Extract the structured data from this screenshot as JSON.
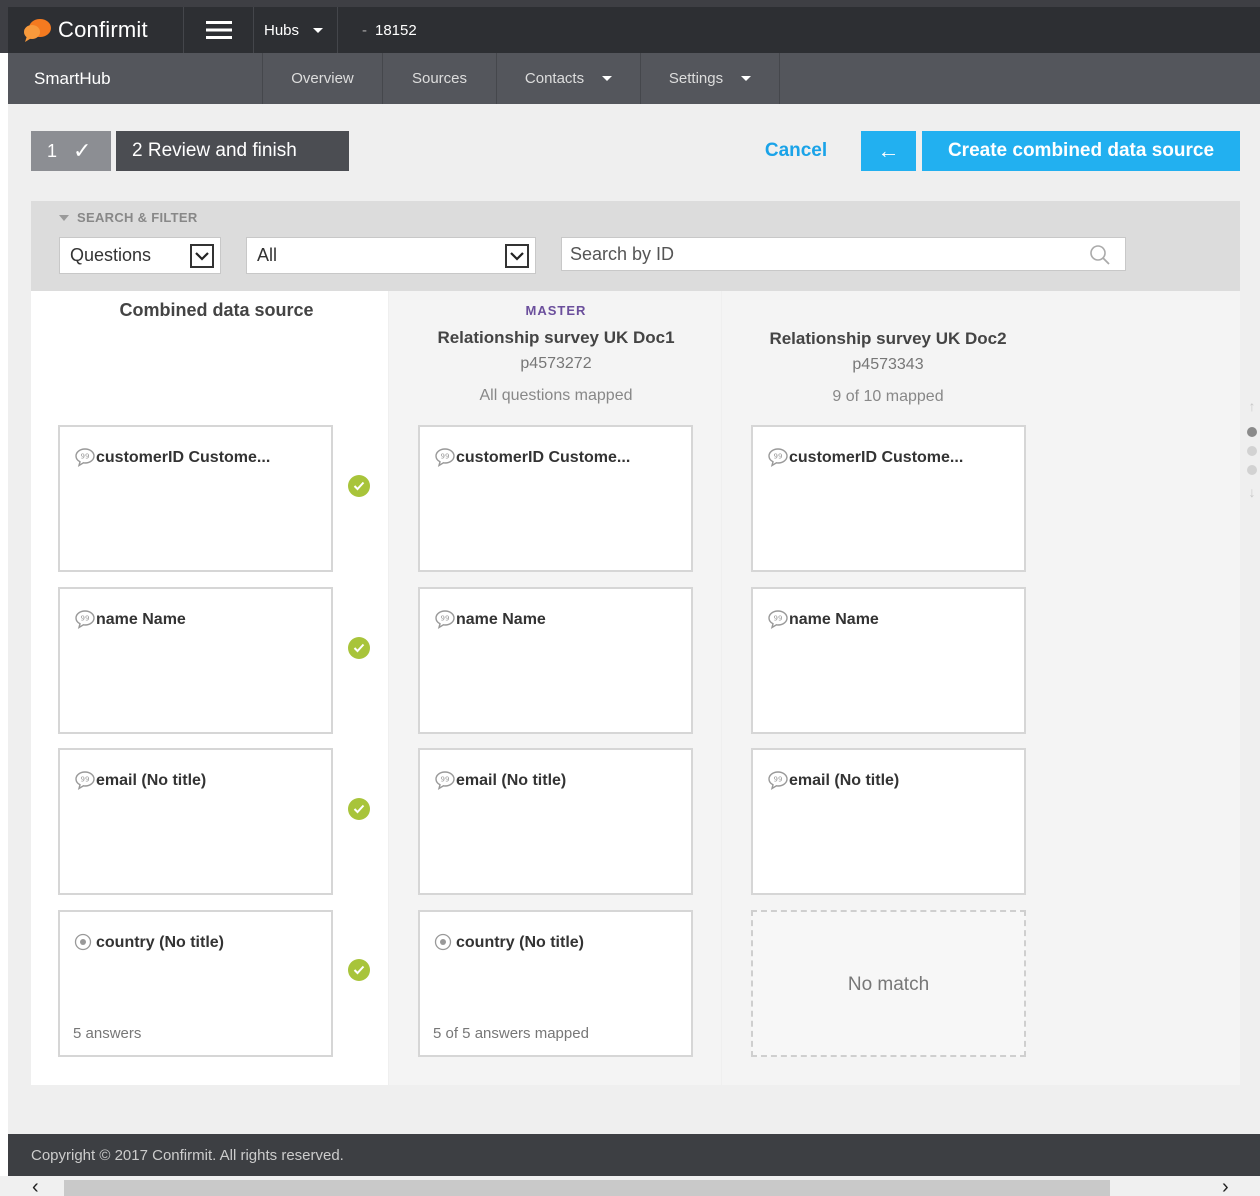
{
  "topbar": {
    "logo": "Confirmit",
    "hubs_label": "Hubs",
    "hub_separator": "-",
    "hub_id": "18152"
  },
  "navbar": {
    "brand": "SmartHub",
    "items": [
      {
        "label": "Overview",
        "has_menu": false
      },
      {
        "label": "Sources",
        "has_menu": false
      },
      {
        "label": "Contacts",
        "has_menu": true
      },
      {
        "label": "Settings",
        "has_menu": true
      }
    ]
  },
  "wizard": {
    "step1_number": "1",
    "step1_check": "✓",
    "step2_label": "2 Review and finish"
  },
  "actions": {
    "cancel": "Cancel",
    "back_arrow": "←",
    "create": "Create combined data source"
  },
  "filter": {
    "title": "SEARCH & FILTER",
    "type_select": "Questions",
    "scope_select": "All",
    "search_placeholder": "Search by ID"
  },
  "columns": {
    "combined": {
      "title": "Combined data source",
      "cards": [
        {
          "label": "customerID Custome...",
          "icon": "speech-bubble-icon",
          "foot": ""
        },
        {
          "label": "name Name",
          "icon": "speech-bubble-icon",
          "foot": ""
        },
        {
          "label": "email (No title)",
          "icon": "speech-bubble-icon",
          "foot": ""
        },
        {
          "label": "country (No title)",
          "icon": "radio-icon",
          "foot": "5 answers"
        }
      ]
    },
    "doc1": {
      "badge": "MASTER",
      "title": "Relationship survey UK Doc1",
      "id": "p4573272",
      "status": "All questions mapped",
      "cards": [
        {
          "label": "customerID Custome...",
          "icon": "speech-bubble-icon",
          "foot": ""
        },
        {
          "label": "name Name",
          "icon": "speech-bubble-icon",
          "foot": ""
        },
        {
          "label": "email (No title)",
          "icon": "speech-bubble-icon",
          "foot": ""
        },
        {
          "label": "country (No title)",
          "icon": "radio-icon",
          "foot": "5 of 5 answers mapped"
        }
      ]
    },
    "doc2": {
      "title": "Relationship survey UK Doc2",
      "id": "p4573343",
      "status": "9 of 10 mapped",
      "cards": [
        {
          "label": "customerID Custome...",
          "icon": "speech-bubble-icon",
          "foot": ""
        },
        {
          "label": "name Name",
          "icon": "speech-bubble-icon",
          "foot": ""
        },
        {
          "label": "email (No title)",
          "icon": "speech-bubble-icon",
          "foot": ""
        }
      ],
      "no_match_label": "No match"
    }
  },
  "footer": {
    "copyright": "Copyright © 2017 Confirmit. All rights reserved."
  },
  "colors": {
    "accent": "#22b0f0",
    "success": "#a8c43a",
    "master": "#6b4f9c"
  }
}
